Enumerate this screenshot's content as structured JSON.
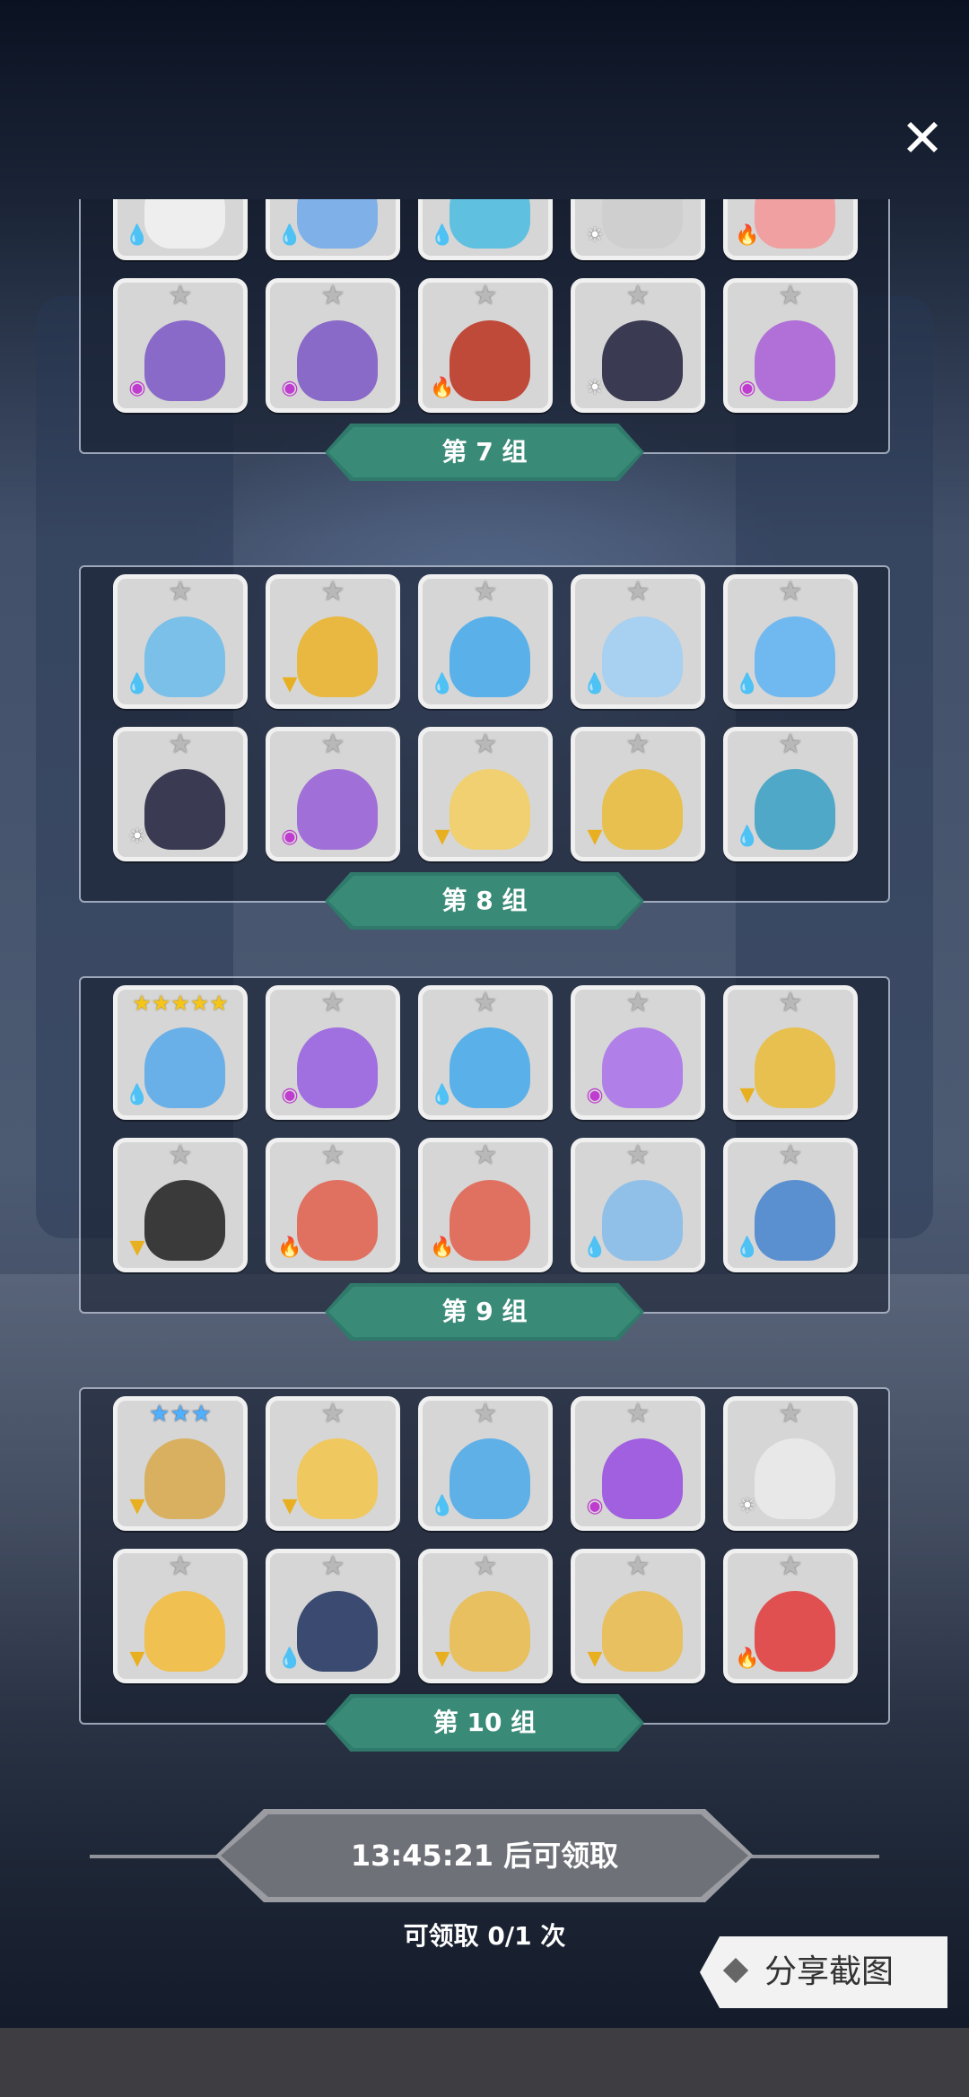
{
  "close_label": "✕",
  "groups": [
    {
      "label": "第 7 组",
      "rows": [
        [
          {
            "element": "water",
            "stars": 0,
            "color": "#eeeeee"
          },
          {
            "element": "water",
            "stars": 0,
            "color": "#7fb0e8"
          },
          {
            "element": "water",
            "stars": 0,
            "color": "#5fc0e0"
          },
          {
            "element": "light",
            "stars": 0,
            "color": "#cfcfcf"
          },
          {
            "element": "fire",
            "stars": 0,
            "color": "#f0a0a0"
          }
        ],
        [
          {
            "element": "dark",
            "stars": 1,
            "color": "#8a6ac8"
          },
          {
            "element": "dark",
            "stars": 1,
            "color": "#8a6ac8"
          },
          {
            "element": "fire",
            "stars": 1,
            "color": "#c04a3a"
          },
          {
            "element": "light",
            "stars": 1,
            "color": "#3a3a52"
          },
          {
            "element": "dark",
            "stars": 1,
            "color": "#b070d8"
          }
        ]
      ]
    },
    {
      "label": "第 8 组",
      "rows": [
        [
          {
            "element": "water",
            "stars": 1,
            "color": "#7ac0e8"
          },
          {
            "element": "earth",
            "stars": 1,
            "color": "#e8b840"
          },
          {
            "element": "water",
            "stars": 1,
            "color": "#5ab0e8"
          },
          {
            "element": "water",
            "stars": 1,
            "color": "#a8d0f0"
          },
          {
            "element": "water",
            "stars": 1,
            "color": "#70b8f0"
          }
        ],
        [
          {
            "element": "light",
            "stars": 1,
            "color": "#3a3a52"
          },
          {
            "element": "dark",
            "stars": 1,
            "color": "#a070d8"
          },
          {
            "element": "earth",
            "stars": 1,
            "color": "#f0d070"
          },
          {
            "element": "earth",
            "stars": 1,
            "color": "#e8c050"
          },
          {
            "element": "water",
            "stars": 1,
            "color": "#50a8c8"
          }
        ]
      ]
    },
    {
      "label": "第 9 组",
      "rows": [
        [
          {
            "element": "water",
            "stars": 5,
            "color": "#6ab0e8"
          },
          {
            "element": "dark",
            "stars": 1,
            "color": "#a070e0"
          },
          {
            "element": "water",
            "stars": 1,
            "color": "#5ab0e8"
          },
          {
            "element": "dark",
            "stars": 1,
            "color": "#b080e8"
          },
          {
            "element": "earth",
            "stars": 1,
            "color": "#e8c050"
          }
        ],
        [
          {
            "element": "earth",
            "stars": 1,
            "color": "#3a3a3a"
          },
          {
            "element": "fire",
            "stars": 1,
            "color": "#e07060"
          },
          {
            "element": "fire",
            "stars": 1,
            "color": "#e07060"
          },
          {
            "element": "water",
            "stars": 1,
            "color": "#90c0e8"
          },
          {
            "element": "water",
            "stars": 1,
            "color": "#5a90d0"
          }
        ]
      ]
    },
    {
      "label": "第 10 组",
      "rows": [
        [
          {
            "element": "earth",
            "stars": 3,
            "color": "#d8b060"
          },
          {
            "element": "earth",
            "stars": 1,
            "color": "#f0c860"
          },
          {
            "element": "water",
            "stars": 1,
            "color": "#60b0e8"
          },
          {
            "element": "dark",
            "stars": 1,
            "color": "#a060e0"
          },
          {
            "element": "light",
            "stars": 1,
            "color": "#e8e8e8"
          }
        ],
        [
          {
            "element": "earth",
            "stars": 1,
            "color": "#f0c050"
          },
          {
            "element": "water",
            "stars": 1,
            "color": "#3a4a70"
          },
          {
            "element": "earth",
            "stars": 1,
            "color": "#e8c060"
          },
          {
            "element": "earth",
            "stars": 1,
            "color": "#e8c060"
          },
          {
            "element": "fire",
            "stars": 1,
            "color": "#e05050"
          }
        ]
      ]
    }
  ],
  "timer_label": "13:45:21 后可领取",
  "claim_count": "可领取 0/1 次",
  "share_label": "分享截图"
}
